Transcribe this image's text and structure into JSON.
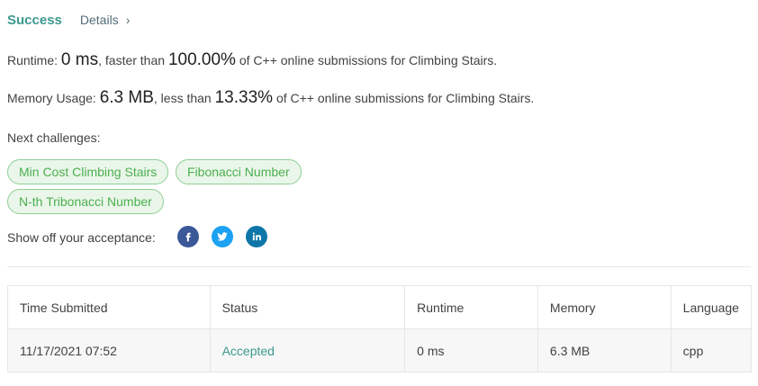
{
  "header": {
    "status_label": "Success",
    "details_label": "Details",
    "details_chevron": "›"
  },
  "runtime": {
    "label": "Runtime: ",
    "value": "0 ms",
    "mid_text": ", faster than ",
    "percent": "100.00%",
    "tail_text": " of C++ online submissions for Climbing Stairs."
  },
  "memory": {
    "label": "Memory Usage: ",
    "value": "6.3 MB",
    "mid_text": ", less than ",
    "percent": "13.33%",
    "tail_text": " of C++ online submissions for Climbing Stairs."
  },
  "next_challenges": {
    "label": "Next challenges:",
    "items": [
      "Min Cost Climbing Stairs",
      "Fibonacci Number",
      "N-th Tribonacci Number"
    ]
  },
  "share": {
    "label": "Show off your acceptance:",
    "icons": [
      "facebook-icon",
      "twitter-icon",
      "linkedin-icon"
    ]
  },
  "submissions_table": {
    "columns": [
      "Time Submitted",
      "Status",
      "Runtime",
      "Memory",
      "Language"
    ],
    "rows": [
      [
        "11/17/2021 07:52",
        "Accepted",
        "0 ms",
        "6.3 MB",
        "cpp"
      ]
    ]
  },
  "colors": {
    "success": "#3c9a8f",
    "chip_text": "#4caf50",
    "chip_border": "#8fcf95",
    "chip_bg": "#eaf6ea",
    "facebook": "#3b5998",
    "twitter": "#1da1f2",
    "linkedin": "#0e76a8"
  }
}
